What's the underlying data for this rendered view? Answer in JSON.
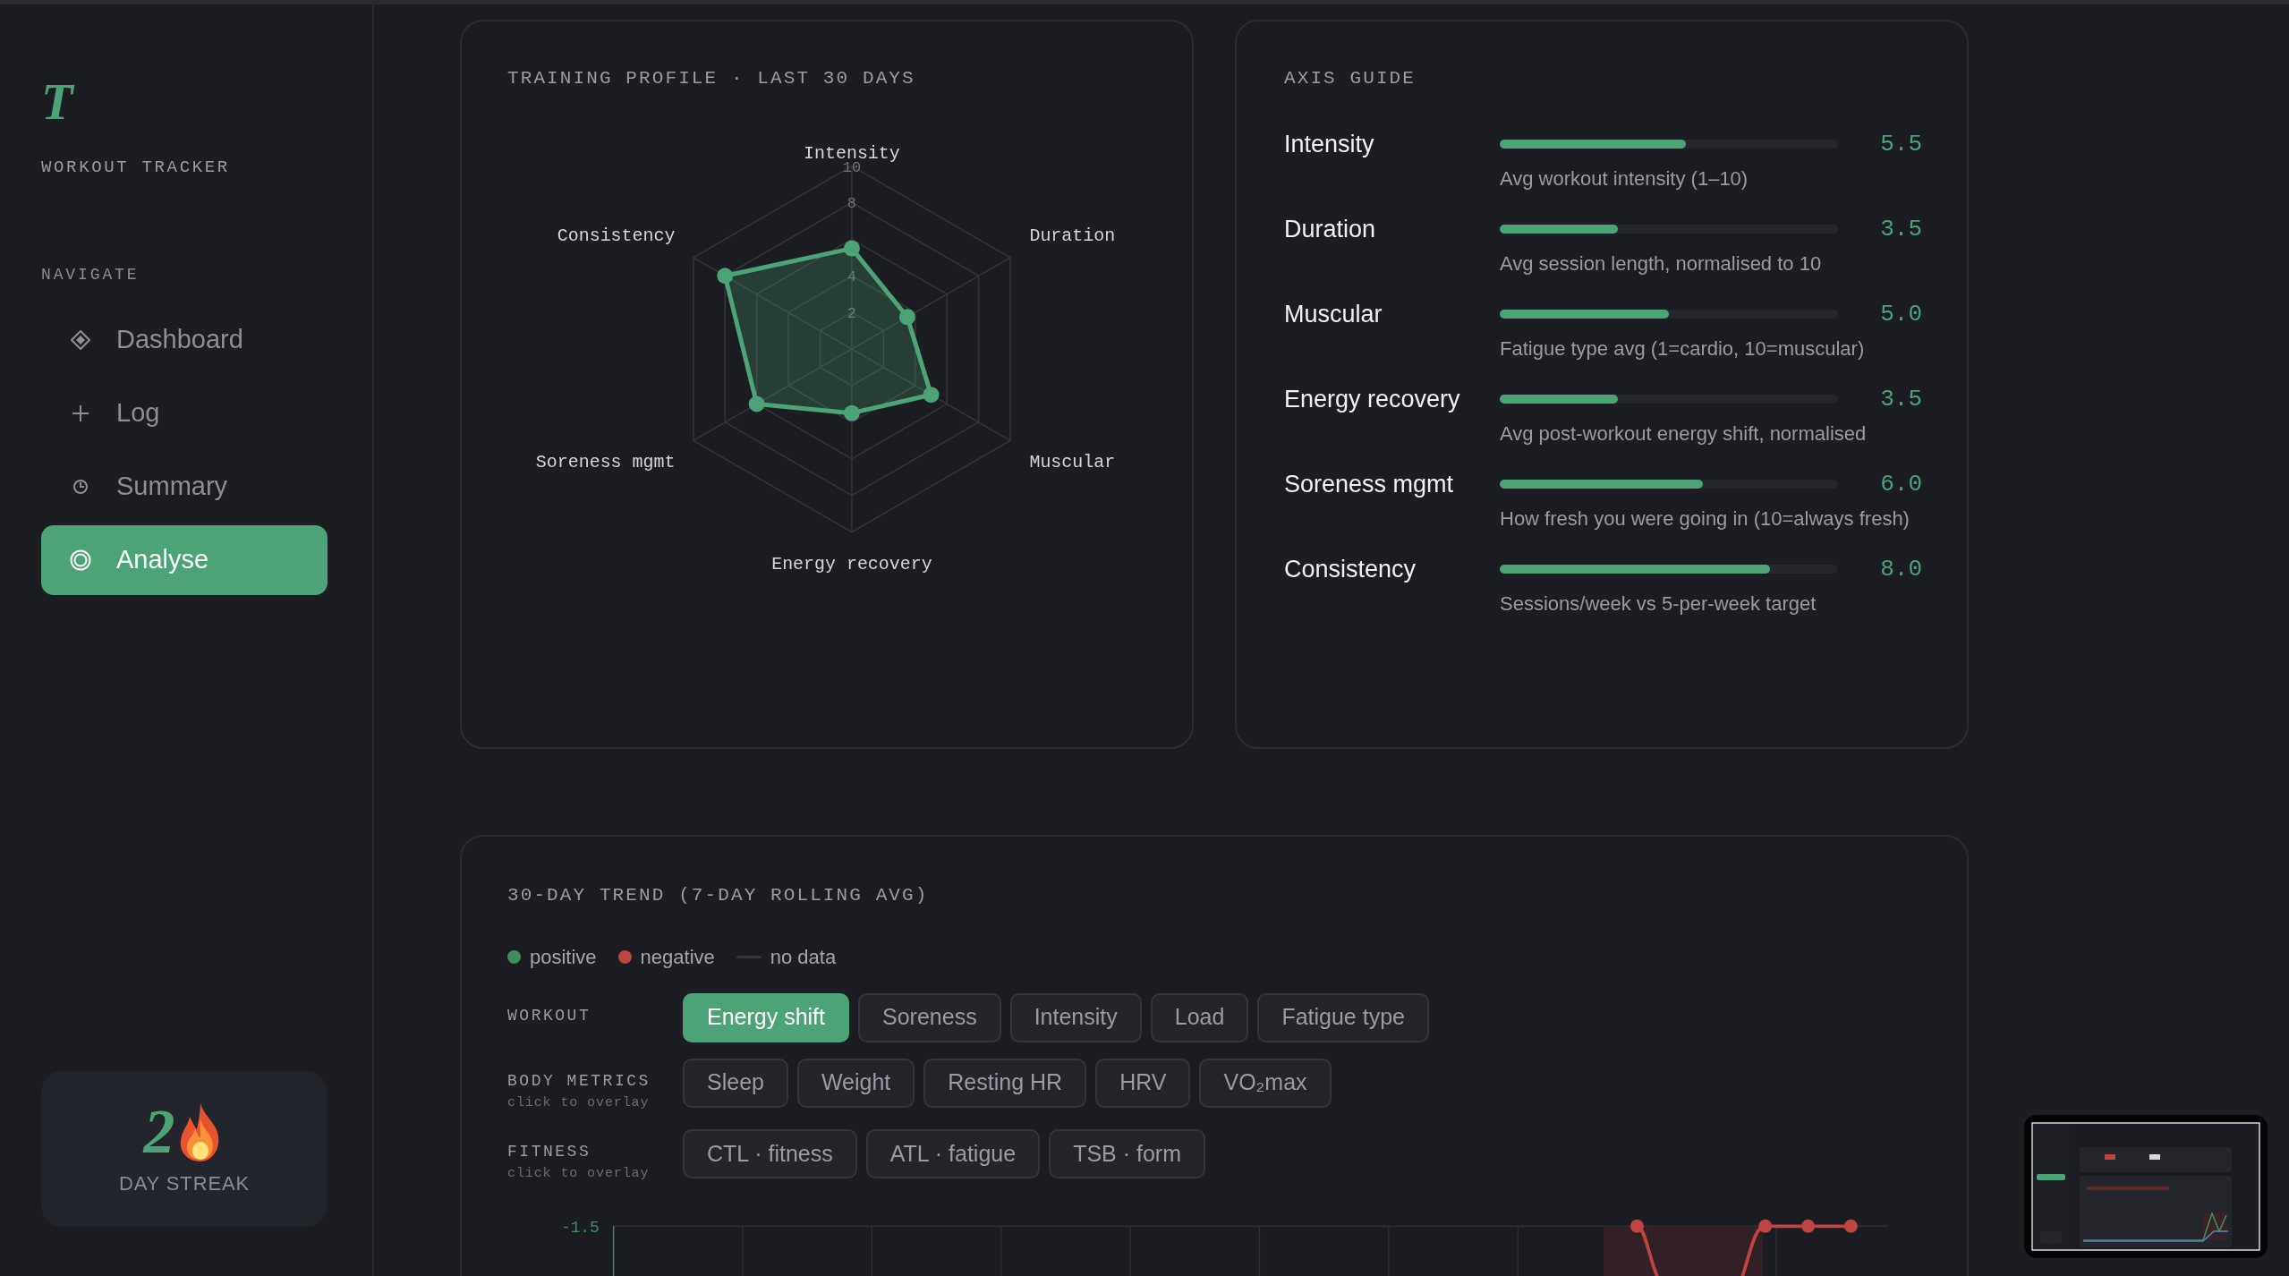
{
  "sidebar": {
    "logo": "T",
    "app_name": "WORKOUT TRACKER",
    "section_label": "NAVIGATE",
    "items": [
      {
        "label": "Dashboard",
        "kind": "diamond",
        "selected": false
      },
      {
        "label": "Log",
        "kind": "plus",
        "selected": false
      },
      {
        "label": "Summary",
        "kind": "clock",
        "selected": false
      },
      {
        "label": "Analyse",
        "kind": "target",
        "selected": true
      }
    ],
    "streak": {
      "count": "2",
      "label": "DAY STREAK"
    }
  },
  "profile_card": {
    "title": "TRAINING PROFILE · LAST 30 DAYS",
    "chart_data": {
      "type": "radar",
      "categories": [
        "Intensity",
        "Duration",
        "Muscular",
        "Energy recovery",
        "Soreness mgmt",
        "Consistency"
      ],
      "series": [
        {
          "color": "#4ca377",
          "values": [
            5.5,
            3.5,
            5.0,
            3.5,
            6.0,
            8.0
          ]
        }
      ],
      "ylim": [
        0,
        10
      ],
      "yticks": [
        2,
        4,
        8,
        10
      ]
    }
  },
  "axis_guide": {
    "title": "AXIS GUIDE",
    "rows": [
      {
        "name": "Intensity",
        "level": 0.55,
        "value": "5.5",
        "description": "Avg workout intensity (1–10)"
      },
      {
        "name": "Duration",
        "level": 0.35,
        "value": "3.5",
        "description": "Avg session length, normalised to 10"
      },
      {
        "name": "Muscular",
        "level": 0.5,
        "value": "5.0",
        "description": "Fatigue type avg (1=cardio, 10=muscular)"
      },
      {
        "name": "Energy recovery",
        "level": 0.35,
        "value": "3.5",
        "description": "Avg post-workout energy shift, normalised"
      },
      {
        "name": "Soreness mgmt",
        "level": 0.6,
        "value": "6.0",
        "description": "How fresh you were going in (10=always fresh)"
      },
      {
        "name": "Consistency",
        "level": 0.8,
        "value": "8.0",
        "description": "Sessions/week vs 5-per-week target"
      }
    ]
  },
  "trend": {
    "title": "30-DAY TREND (7-DAY ROLLING AVG)",
    "legend": [
      {
        "label": "positive",
        "kind": "dot",
        "color": "#3f8f5e"
      },
      {
        "label": "negative",
        "kind": "dot",
        "color": "#c0443f"
      },
      {
        "label": "no data",
        "kind": "line",
        "color": "#34373d"
      }
    ],
    "groups": [
      {
        "label": "WORKOUT",
        "chips": [
          {
            "label": "Energy shift",
            "selected": true
          },
          {
            "label": "Soreness",
            "selected": false
          },
          {
            "label": "Intensity",
            "selected": false
          },
          {
            "label": "Load",
            "selected": false
          },
          {
            "label": "Fatigue type",
            "selected": false
          }
        ]
      },
      {
        "label": "BODY METRICS",
        "hint": "click to overlay",
        "chips": [
          {
            "label": "Sleep",
            "selected": false
          },
          {
            "label": "Weight",
            "selected": false
          },
          {
            "label": "Resting HR",
            "selected": false
          },
          {
            "label": "HRV",
            "selected": false
          },
          {
            "label": "VO₂max",
            "selected": false
          }
        ]
      },
      {
        "label": "FITNESS",
        "hint": "click to overlay",
        "chips": [
          {
            "label": "CTL · fitness",
            "selected": false
          },
          {
            "label": "ATL · fatigue",
            "selected": false
          },
          {
            "label": "TSB · form",
            "selected": false
          }
        ]
      }
    ],
    "y_tick": "-1.5"
  }
}
